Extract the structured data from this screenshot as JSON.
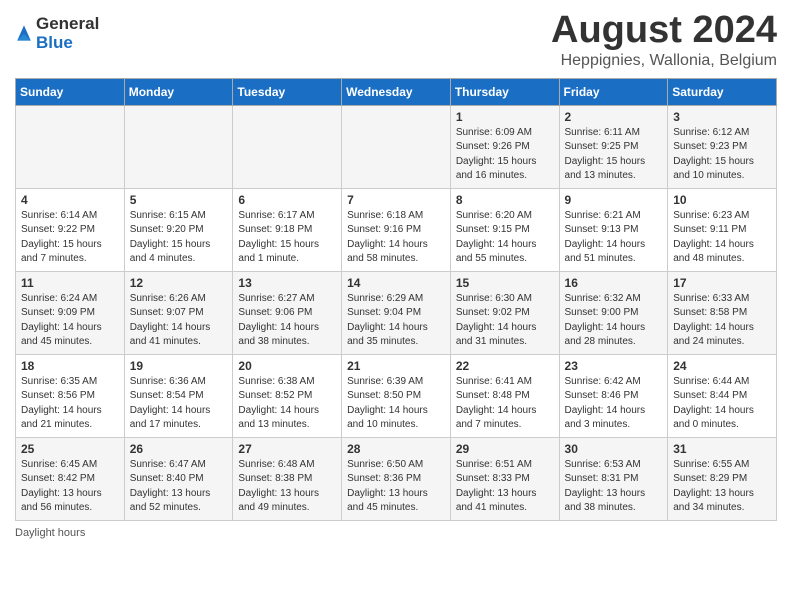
{
  "header": {
    "logo_general": "General",
    "logo_blue": "Blue",
    "month_title": "August 2024",
    "location": "Heppignies, Wallonia, Belgium"
  },
  "days_of_week": [
    "Sunday",
    "Monday",
    "Tuesday",
    "Wednesday",
    "Thursday",
    "Friday",
    "Saturday"
  ],
  "weeks": [
    [
      {
        "day": "",
        "info": ""
      },
      {
        "day": "",
        "info": ""
      },
      {
        "day": "",
        "info": ""
      },
      {
        "day": "",
        "info": ""
      },
      {
        "day": "1",
        "info": "Sunrise: 6:09 AM\nSunset: 9:26 PM\nDaylight: 15 hours\nand 16 minutes."
      },
      {
        "day": "2",
        "info": "Sunrise: 6:11 AM\nSunset: 9:25 PM\nDaylight: 15 hours\nand 13 minutes."
      },
      {
        "day": "3",
        "info": "Sunrise: 6:12 AM\nSunset: 9:23 PM\nDaylight: 15 hours\nand 10 minutes."
      }
    ],
    [
      {
        "day": "4",
        "info": "Sunrise: 6:14 AM\nSunset: 9:22 PM\nDaylight: 15 hours\nand 7 minutes."
      },
      {
        "day": "5",
        "info": "Sunrise: 6:15 AM\nSunset: 9:20 PM\nDaylight: 15 hours\nand 4 minutes."
      },
      {
        "day": "6",
        "info": "Sunrise: 6:17 AM\nSunset: 9:18 PM\nDaylight: 15 hours\nand 1 minute."
      },
      {
        "day": "7",
        "info": "Sunrise: 6:18 AM\nSunset: 9:16 PM\nDaylight: 14 hours\nand 58 minutes."
      },
      {
        "day": "8",
        "info": "Sunrise: 6:20 AM\nSunset: 9:15 PM\nDaylight: 14 hours\nand 55 minutes."
      },
      {
        "day": "9",
        "info": "Sunrise: 6:21 AM\nSunset: 9:13 PM\nDaylight: 14 hours\nand 51 minutes."
      },
      {
        "day": "10",
        "info": "Sunrise: 6:23 AM\nSunset: 9:11 PM\nDaylight: 14 hours\nand 48 minutes."
      }
    ],
    [
      {
        "day": "11",
        "info": "Sunrise: 6:24 AM\nSunset: 9:09 PM\nDaylight: 14 hours\nand 45 minutes."
      },
      {
        "day": "12",
        "info": "Sunrise: 6:26 AM\nSunset: 9:07 PM\nDaylight: 14 hours\nand 41 minutes."
      },
      {
        "day": "13",
        "info": "Sunrise: 6:27 AM\nSunset: 9:06 PM\nDaylight: 14 hours\nand 38 minutes."
      },
      {
        "day": "14",
        "info": "Sunrise: 6:29 AM\nSunset: 9:04 PM\nDaylight: 14 hours\nand 35 minutes."
      },
      {
        "day": "15",
        "info": "Sunrise: 6:30 AM\nSunset: 9:02 PM\nDaylight: 14 hours\nand 31 minutes."
      },
      {
        "day": "16",
        "info": "Sunrise: 6:32 AM\nSunset: 9:00 PM\nDaylight: 14 hours\nand 28 minutes."
      },
      {
        "day": "17",
        "info": "Sunrise: 6:33 AM\nSunset: 8:58 PM\nDaylight: 14 hours\nand 24 minutes."
      }
    ],
    [
      {
        "day": "18",
        "info": "Sunrise: 6:35 AM\nSunset: 8:56 PM\nDaylight: 14 hours\nand 21 minutes."
      },
      {
        "day": "19",
        "info": "Sunrise: 6:36 AM\nSunset: 8:54 PM\nDaylight: 14 hours\nand 17 minutes."
      },
      {
        "day": "20",
        "info": "Sunrise: 6:38 AM\nSunset: 8:52 PM\nDaylight: 14 hours\nand 13 minutes."
      },
      {
        "day": "21",
        "info": "Sunrise: 6:39 AM\nSunset: 8:50 PM\nDaylight: 14 hours\nand 10 minutes."
      },
      {
        "day": "22",
        "info": "Sunrise: 6:41 AM\nSunset: 8:48 PM\nDaylight: 14 hours\nand 7 minutes."
      },
      {
        "day": "23",
        "info": "Sunrise: 6:42 AM\nSunset: 8:46 PM\nDaylight: 14 hours\nand 3 minutes."
      },
      {
        "day": "24",
        "info": "Sunrise: 6:44 AM\nSunset: 8:44 PM\nDaylight: 14 hours\nand 0 minutes."
      }
    ],
    [
      {
        "day": "25",
        "info": "Sunrise: 6:45 AM\nSunset: 8:42 PM\nDaylight: 13 hours\nand 56 minutes."
      },
      {
        "day": "26",
        "info": "Sunrise: 6:47 AM\nSunset: 8:40 PM\nDaylight: 13 hours\nand 52 minutes."
      },
      {
        "day": "27",
        "info": "Sunrise: 6:48 AM\nSunset: 8:38 PM\nDaylight: 13 hours\nand 49 minutes."
      },
      {
        "day": "28",
        "info": "Sunrise: 6:50 AM\nSunset: 8:36 PM\nDaylight: 13 hours\nand 45 minutes."
      },
      {
        "day": "29",
        "info": "Sunrise: 6:51 AM\nSunset: 8:33 PM\nDaylight: 13 hours\nand 41 minutes."
      },
      {
        "day": "30",
        "info": "Sunrise: 6:53 AM\nSunset: 8:31 PM\nDaylight: 13 hours\nand 38 minutes."
      },
      {
        "day": "31",
        "info": "Sunrise: 6:55 AM\nSunset: 8:29 PM\nDaylight: 13 hours\nand 34 minutes."
      }
    ]
  ],
  "footer": {
    "daylight_label": "Daylight hours"
  }
}
